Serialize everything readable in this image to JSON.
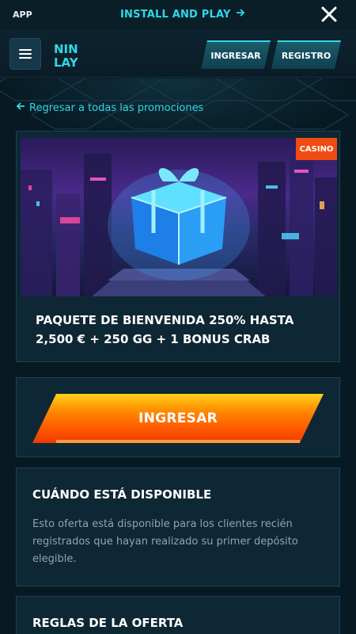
{
  "app_bar": {
    "app_label": "APP",
    "install_label": "INSTALL AND PLAY",
    "install_icon": "arrow-right-icon",
    "close_icon": "close-icon"
  },
  "header": {
    "menu_icon": "hamburger-menu-icon",
    "logo_text_top": "NIN",
    "logo_text_bottom": "LAY",
    "login_label": "INGRESAR",
    "register_label": "REGISTRO"
  },
  "back_link": {
    "icon": "arrow-left-icon",
    "label": "Regresar a todas las promociones"
  },
  "promo": {
    "badge": "CASINO",
    "title": "PAQUETE DE BIENVENIDA 250% HASTA 2,500 € + 250 GG + 1 BONUS CRAB"
  },
  "cta": {
    "label": "INGRESAR"
  },
  "availability": {
    "title": "CUÁNDO ESTÁ DISPONIBLE",
    "text": "Esto oferta está disponible para los clientes recién registrados que hayan realizado su primer depósito elegible."
  },
  "rules": {
    "title": "REGLAS DE LA OFERTA"
  },
  "colors": {
    "accent_cyan": "#2fd8e6",
    "background": "#071a24",
    "card": "#0e2735",
    "badge_orange": "#f04b12",
    "cta_orange": "#ff5a00",
    "cta_yellow": "#ffd21a"
  }
}
